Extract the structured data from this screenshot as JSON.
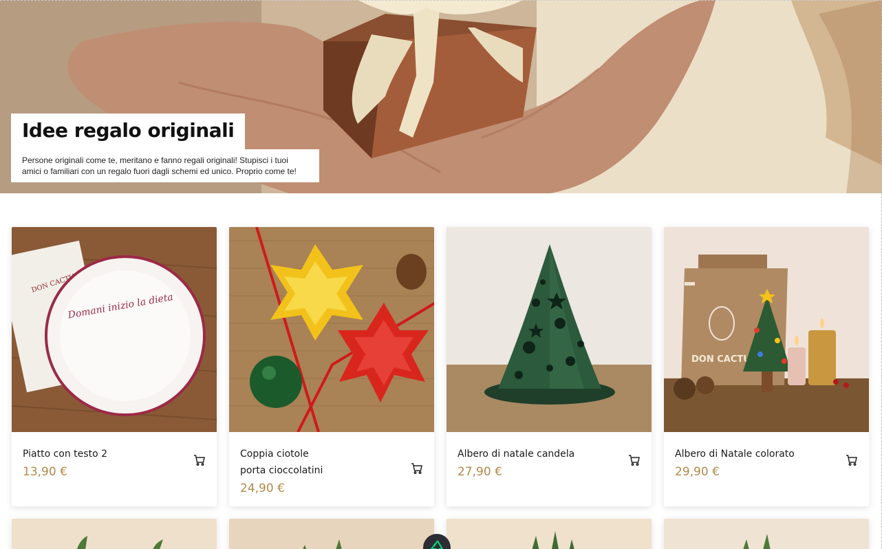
{
  "hero": {
    "title": "Idee regalo originali",
    "description": "Persone originali come te, meritano e fanno regali originali! Stupisci i tuoi amici o familiari con un regalo fuori dagli schemi ed unico. Proprio come te!"
  },
  "products": [
    {
      "name": "Piatto con testo 2",
      "price": "13,90 €",
      "image": "plate-with-text"
    },
    {
      "name": "Coppia ciotole porta cioccolatini",
      "price": "24,90 €",
      "image": "star-bowls"
    },
    {
      "name": "Albero di natale candela",
      "price": "27,90 €",
      "image": "tree-candle"
    },
    {
      "name": "Albero di Natale colorato",
      "price": "29,90 €",
      "image": "colored-tree"
    }
  ],
  "plate_text": "Domani inizio la dieta",
  "brand_text": "DON CACTUS",
  "icons": {
    "cart": "shopping-cart-icon",
    "fab": "nuxt-devtools-icon"
  },
  "colors": {
    "price": "#b08a4a",
    "fab": "#2d2d33",
    "accent": "#00dc82"
  }
}
